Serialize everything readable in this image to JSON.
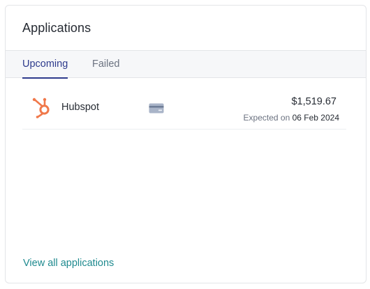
{
  "card": {
    "title": "Applications",
    "tabs": [
      {
        "label": "Upcoming",
        "active": true
      },
      {
        "label": "Failed",
        "active": false
      }
    ],
    "rows": [
      {
        "app_name": "Hubspot",
        "app_icon": "hubspot-icon",
        "payment_icon": "credit-card-icon",
        "amount": "$1,519.67",
        "expected_label": "Expected on",
        "expected_date": "06 Feb 2024"
      }
    ],
    "footer_link": "View all applications"
  },
  "colors": {
    "accent": "#2d3a8c",
    "link": "#1f8a8f",
    "hubspot": "#f0784a"
  }
}
